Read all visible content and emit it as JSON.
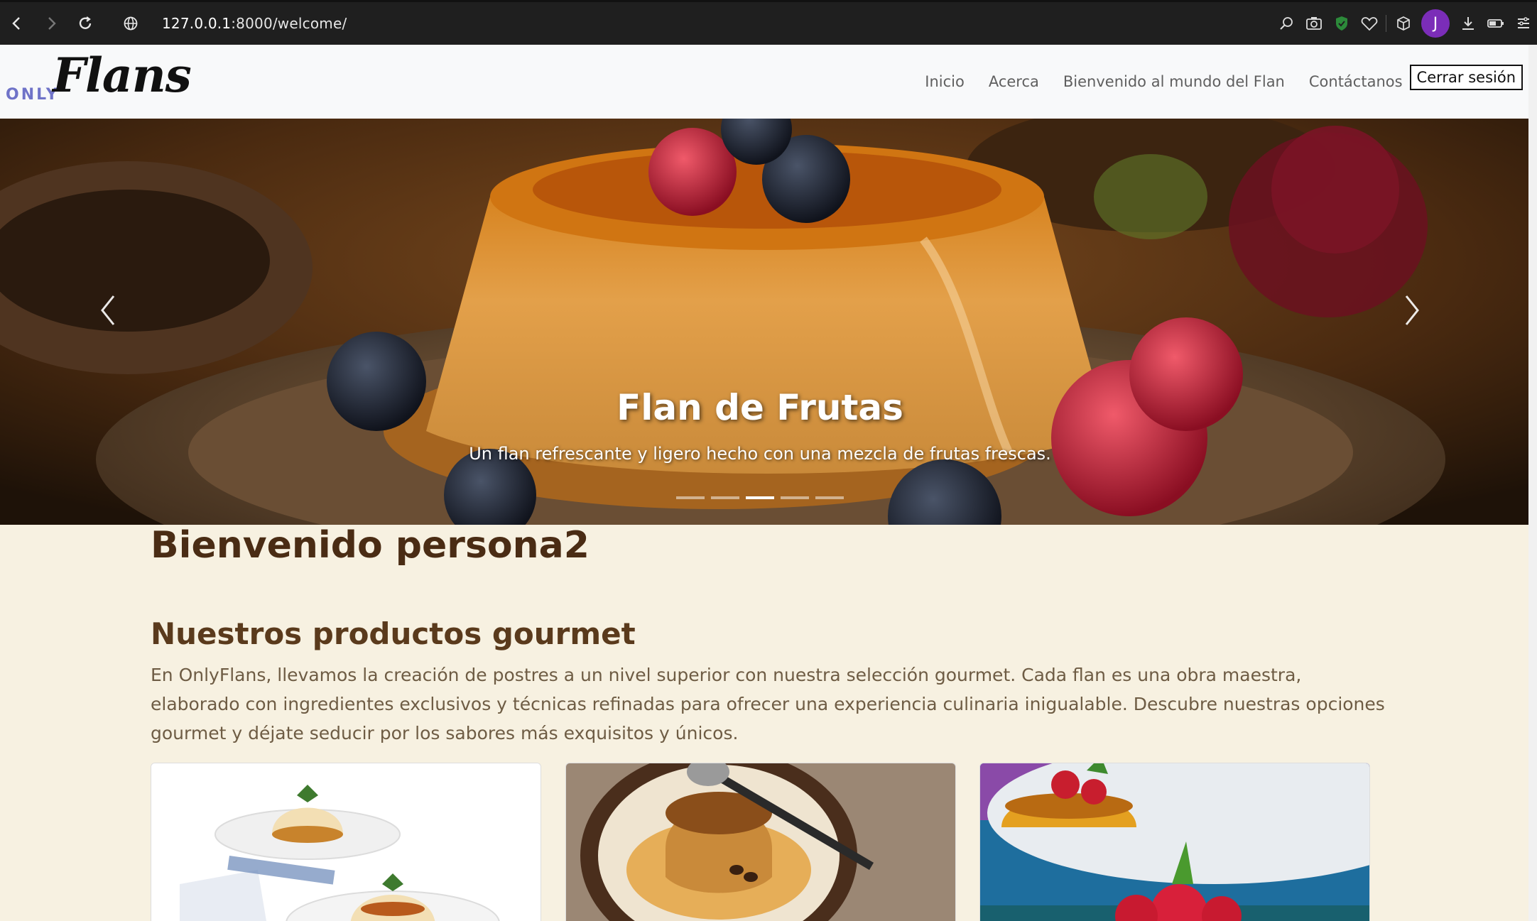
{
  "browser": {
    "url_host": "127.0.0.1",
    "url_rest": ":8000/welcome/",
    "avatar_letter": "J"
  },
  "navbar": {
    "logo_only": "ONLY",
    "logo_flans": "Flans",
    "links": [
      "Inicio",
      "Acerca",
      "Bienvenido al mundo del Flan",
      "Contáctanos"
    ],
    "logout_label": "Cerrar sesión"
  },
  "carousel": {
    "title": "Flan de Frutas",
    "text": "Un flan refrescante y ligero hecho con una mezcla de frutas frescas.",
    "slide_count": 5,
    "active_index": 2
  },
  "main": {
    "welcome": "Bienvenido persona2",
    "products_title": "Nuestros productos gourmet",
    "products_desc": "En OnlyFlans, llevamos la creación de postres a un nivel superior con nuestra selección gourmet. Cada flan es una obra maestra, elaborado con ingredientes exclusivos y técnicas refinadas para ofrecer una experiencia culinaria inigualable. Descubre nuestras opciones gourmet y déjate seducir por los sabores más exquisitos y únicos."
  },
  "colors": {
    "page_bg": "#f7f1e1",
    "heading": "#4a2c14",
    "logo_accent": "#6f73c8",
    "avatar": "#7b2db8"
  }
}
